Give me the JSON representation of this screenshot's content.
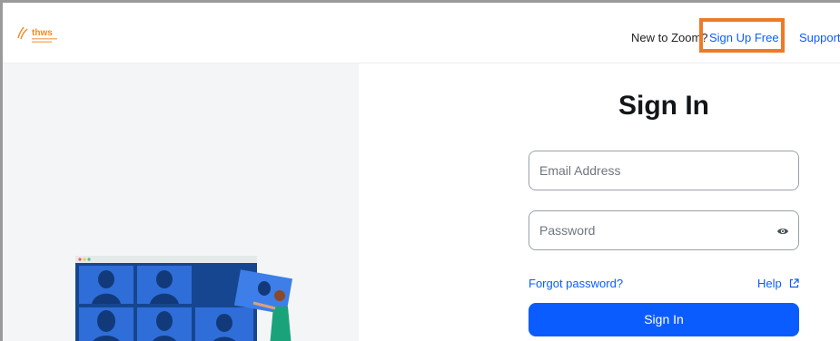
{
  "header": {
    "logo_text": "thws",
    "new_to_text": "New to Zoom?",
    "signup_label": "Sign Up Free",
    "support_label": "Support"
  },
  "form": {
    "title": "Sign In",
    "email_placeholder": "Email Address",
    "password_placeholder": "Password",
    "forgot_label": "Forgot password?",
    "help_label": "Help",
    "signin_label": "Sign In"
  },
  "icons": {
    "password_toggle": "eye-icon",
    "help_external": "external-link-icon"
  },
  "colors": {
    "accent": "#0b5cff",
    "highlight": "#ef7a25",
    "logo": "#f08a24"
  }
}
